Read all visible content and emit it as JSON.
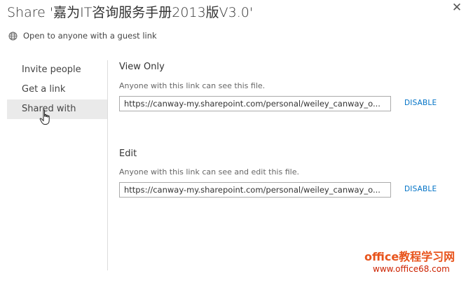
{
  "dialog": {
    "title": "Share '嘉为IT咨询服务手册2013版V3.0'",
    "close_label": "✕",
    "subtitle": "Open to anyone with a guest link",
    "subtitle_icon": "globe-icon"
  },
  "sidebar": {
    "items": [
      {
        "label": "Invite people",
        "selected": false
      },
      {
        "label": "Get a link",
        "selected": false
      },
      {
        "label": "Shared with",
        "selected": true
      }
    ]
  },
  "view_only": {
    "heading": "View Only",
    "description": "Anyone with this link can see this file.",
    "link_value": "https://canway-my.sharepoint.com/personal/weiley_canway_o...",
    "disable_label": "DISABLE"
  },
  "edit": {
    "heading": "Edit",
    "description": "Anyone with this link can see and edit this file.",
    "link_value": "https://canway-my.sharepoint.com/personal/weiley_canway_o...",
    "disable_label": "DISABLE"
  },
  "watermark": {
    "main": "office教程学习网",
    "sub": "www.office68.com"
  },
  "colors": {
    "accent": "#0072c6",
    "selected_bg": "#eaeaea",
    "watermark": "#e8541c"
  }
}
